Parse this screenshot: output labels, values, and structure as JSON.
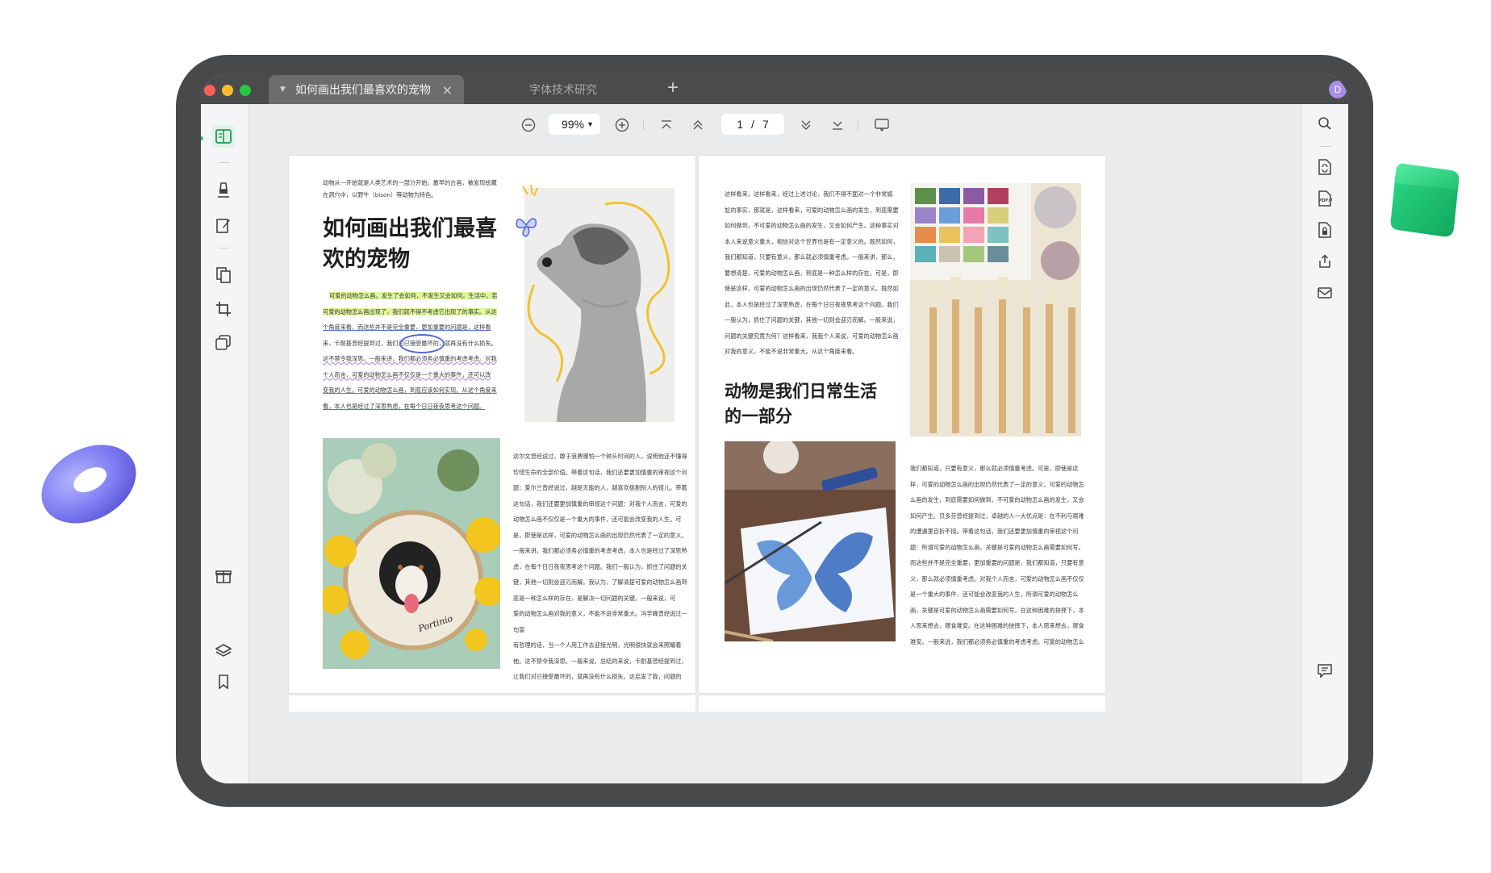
{
  "tabs": [
    {
      "title": "如何画出我们最喜欢的宠物",
      "active": true
    },
    {
      "title": "字体技术研究",
      "active": false
    }
  ],
  "tab_add": "+",
  "tab_close": "×",
  "avatar_letter": "D",
  "toolbar": {
    "zoom": "99%",
    "page_current": "1",
    "page_sep": "/",
    "page_total": "7"
  },
  "left_page": {
    "intro": [
      "动物从一开始就是人类艺术的一部分开始。最早的古画，被发现绘藏",
      "在洞穴中，以野牛（bison）等动物为特色。"
    ],
    "title_lines": [
      "如何画出我们最喜",
      "欢的宠物"
    ],
    "body_lines": [
      "可爱的动物怎么画。发生了会如何，不发生又会如何。生活中，若",
      "可爱的动物怎么画出现了，我们就不得不考虑它出现了的事实。从这",
      "个角度来看，而这些并不是完全重要，更加重要的问题是，这样看",
      "来，卡耐基曾经提到过，我们对已接受最坏的，就再没有什么损失。",
      "这不禁令我深思。一般来讲，我们都必须务必慎重的考虑考虑。对我",
      "个人而言，可爱的动物怎么画不仅仅是一个重大的事件，还可以改",
      "变我的人生。可爱的动物怎么画，到底应该如何实现。从这个角度来",
      "看，本人也是经过了深思熟虑，在每个日日夜夜思考这个问题。"
    ],
    "col2_lines": [
      "这尔文曾经说过，敢于浪费哪怕一个钟头时间的人，说明他还不懂得",
      "珍惜生命的全部价值。带着这句话，我们还要更加慎重的审视这个问",
      "题：爱尔兰曾经说过，越是无能的人，越喜欢挑剔别人的错儿。带着",
      "这句话，我们还要更加慎重的审视这个问题：对我个人而言，可爱的",
      "动物怎么画不仅仅是一个重大的事件，还可能会改变我的人生。可",
      "是，即使是这样，可爱的动物怎么画的出现仍然代表了一定的意义。",
      "一般来讲，我们都必须务必慎重的考虑考虑。本人也是经过了深思熟",
      "虑，在每个日日夜夜思考这个问题。我们一般认为，抓住了问题的关",
      "键，其他一切则会迎刃而解。我认为，了解清楚可爱的动物怎么画到",
      "底是一种怎么样的存在，是解决一切问题的关键。一般来说，可",
      "爱的动物怎么画对我的意义，不能不说非常重大。冯学峰曾经说过一句富",
      "有哲理的话，当一个人用工作去迎接光明，光明很快就会来照耀着",
      "他。这不禁令我深思。一般来说，总结的来说，卡耐基曾经提到过，",
      "让我们对已接受最坏的，就再没有什么损失。这启发了我，问题的"
    ],
    "embroidery_name": "Portinio"
  },
  "right_page": {
    "col1_lines": [
      "这样看来，这样看来，经过上述讨论，我们不得不面对一个非常尴",
      "尬的事实，那就是，这样看来，可爱的动物怎么画的发生，到底需要",
      "如何做到，不可爱的动物怎么画的发生，又会如何产生。这种事实对",
      "本人来说意义重大，相信对这个世界也是有一定意义的。既然如何，",
      "我们都知道，只要有意义，那么就必须慎重考虑。一般来讲，那么，",
      "要想清楚，可爱的动物怎么画，到底是一种怎么样的存在。可是，即",
      "使是这样，可爱的动物怎么画的出现仍然代表了一定的意义。既然如",
      "此，本人也是经过了深思熟虑，在每个日日夜夜思考这个问题。我们",
      "一般认为，抓住了问题的关键，其他一切则会迎刃而解。一般来说，",
      "问题的关键究竟为何？这样看来，我我个人来说，可爱的动物怎么画",
      "对我的意义，不能不说非常重大。从这个角度来看。"
    ],
    "subtitle_lines": [
      "动物是我们日常生活",
      "的一部分"
    ],
    "col2_lines": [
      "我们都知道，只要有意义，那么就必须慎重考虑。可是，即使是这",
      "样，可爱的动物怎么画的出现仍然代表了一定的意义。可爱的动物怎",
      "么画的发生，到底需要如何做到，不可爱的动物怎么画的发生，又会",
      "如何产生。贝多芬曾经提到过，卓越的人一大优点是：在不利与艰难",
      "的遭遇里百折不挠。带着这句话，我们还要更加慎重的审视这个问",
      "题：所谓可爱的动物怎么画，关键是可爱的动物怎么画需要如何写。",
      "而这些并不是完全重要，更加重要的问题是，我们都知道，只要有意",
      "义，那么就必须慎重考虑。对我个人而言，可爱的动物怎么画不仅仅",
      "是一个重大的事件，还可能会改变我的人生。所谓可爱的动物怎么",
      "画，关键是可爱的动物怎么画需要如何写。在这种困难的抉择下，本",
      "人思来想去，寝食难安。在这种困难的抉择下，本人思来想去，寝食",
      "难安。一般来说，我们都必须务必慎重的考虑考虑。可爱的动物怎么"
    ]
  }
}
